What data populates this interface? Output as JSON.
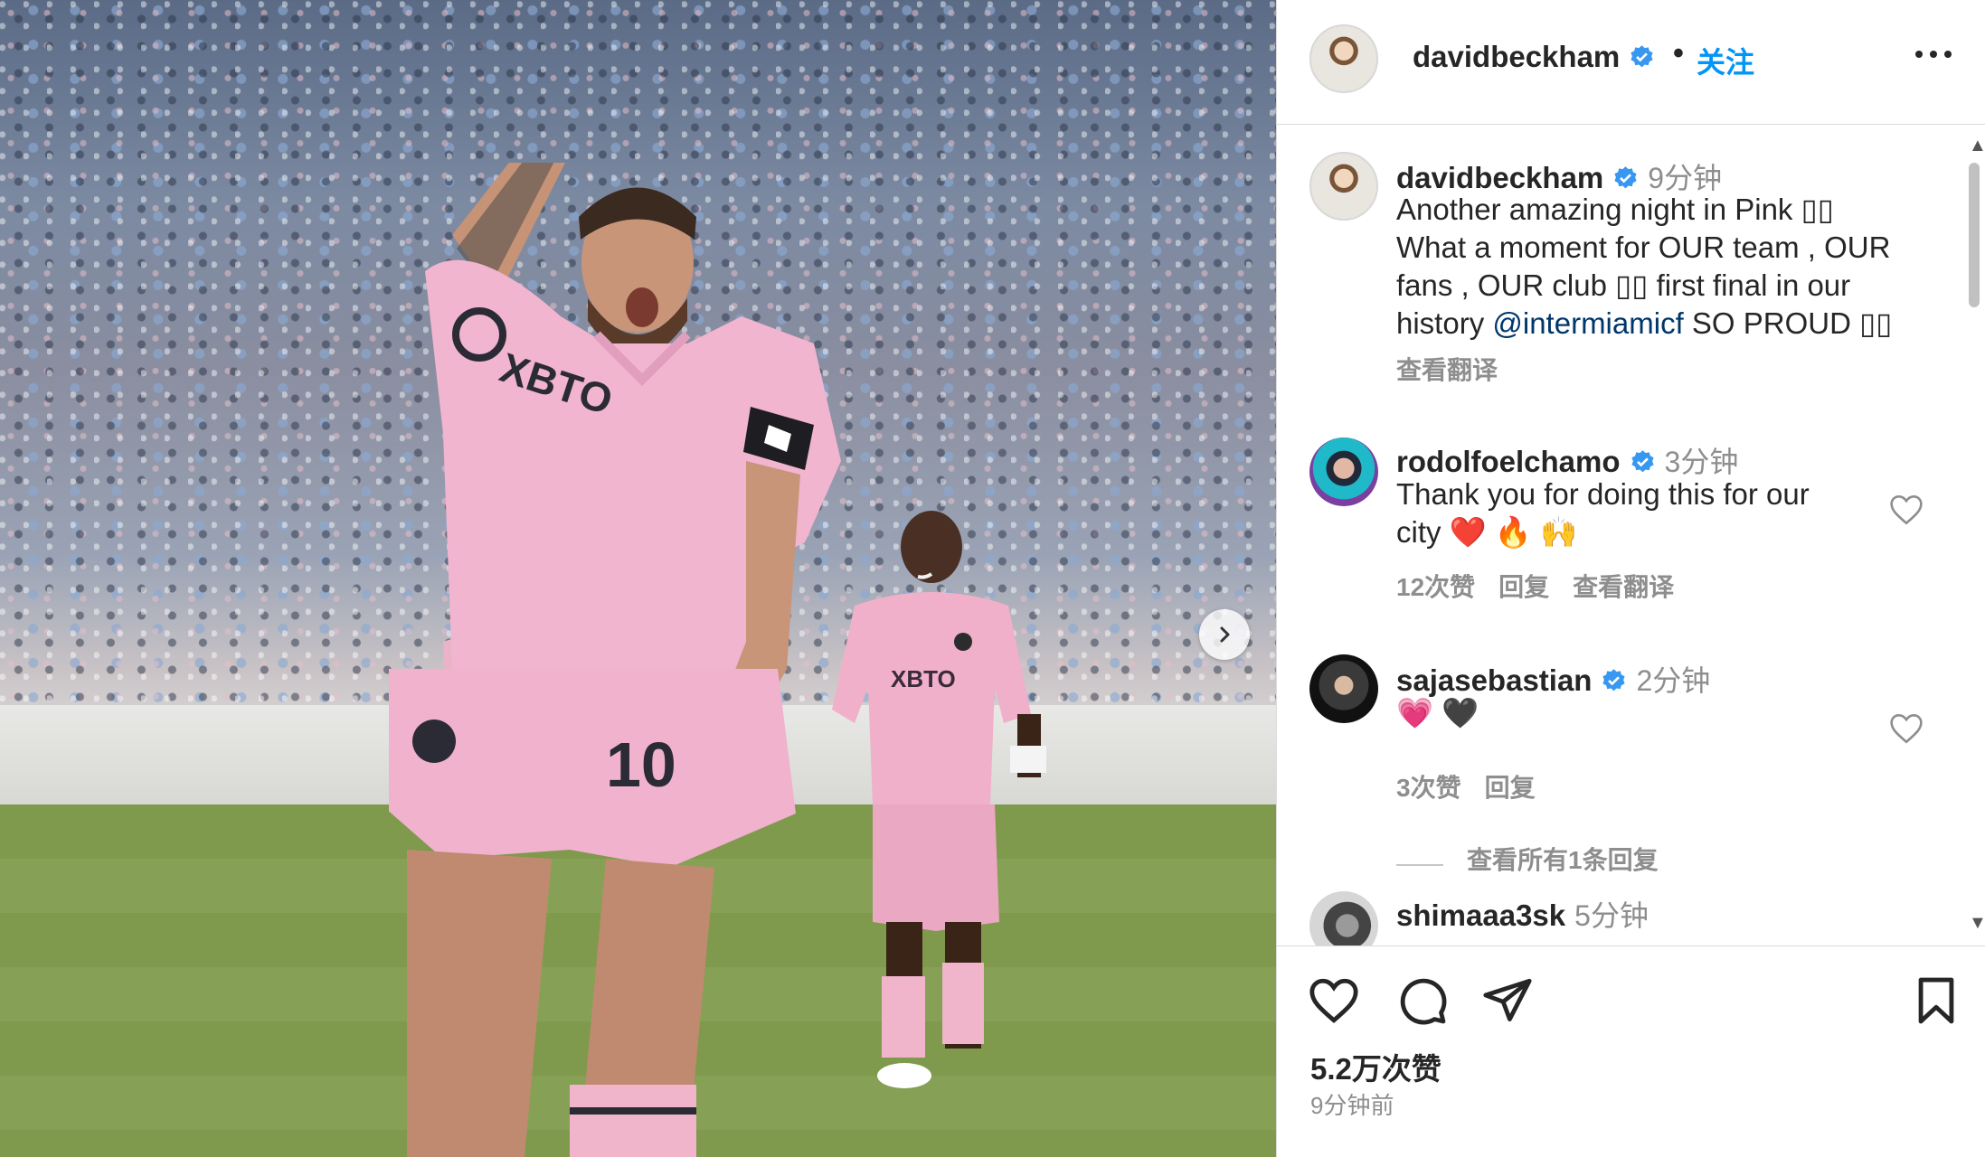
{
  "post": {
    "username": "davidbeckham",
    "follow_label": "关注",
    "dot": "•"
  },
  "caption": {
    "username": "davidbeckham",
    "time": "9分钟",
    "line1": "Another amazing night in Pink ▯▯",
    "line2": "What a moment for OUR team , OUR",
    "line3": "fans , OUR club ▯▯ first final in our",
    "line4_pre": "history ",
    "mention": "@intermiamicf",
    "line4_post": " SO PROUD ▯▯",
    "translate": "查看翻译"
  },
  "comments": [
    {
      "username": "rodolfoelchamo",
      "verified": true,
      "time": "3分钟",
      "line1": "Thank you for doing this for our",
      "line2": "city ❤️ 🔥 🙌",
      "likes": "12次赞",
      "reply": "回复",
      "translate": "查看翻译"
    },
    {
      "username": "sajasebastian",
      "verified": true,
      "time": "2分钟",
      "line1": "💗 🖤",
      "likes": "3次赞",
      "reply": "回复",
      "view_replies": "查看所有1条回复"
    },
    {
      "username": "shimaaa3sk",
      "verified": false,
      "time": "5分钟"
    }
  ],
  "actions": {
    "likes_count": "5.2万次赞",
    "posted_ago": "9分钟前"
  },
  "icons": {
    "header_more": "more-horizontal-icon",
    "verified": "verified-badge-icon",
    "next": "chevron-right-icon",
    "like": "heart-icon",
    "comment": "comment-bubble-icon",
    "share": "paper-plane-icon",
    "save": "bookmark-icon"
  },
  "colors": {
    "link_blue": "#0095f6",
    "mention_blue": "#00376b",
    "verified_blue": "#3897f0",
    "muted": "#8e8e8e",
    "jersey_pink": "#f2b5cf"
  }
}
